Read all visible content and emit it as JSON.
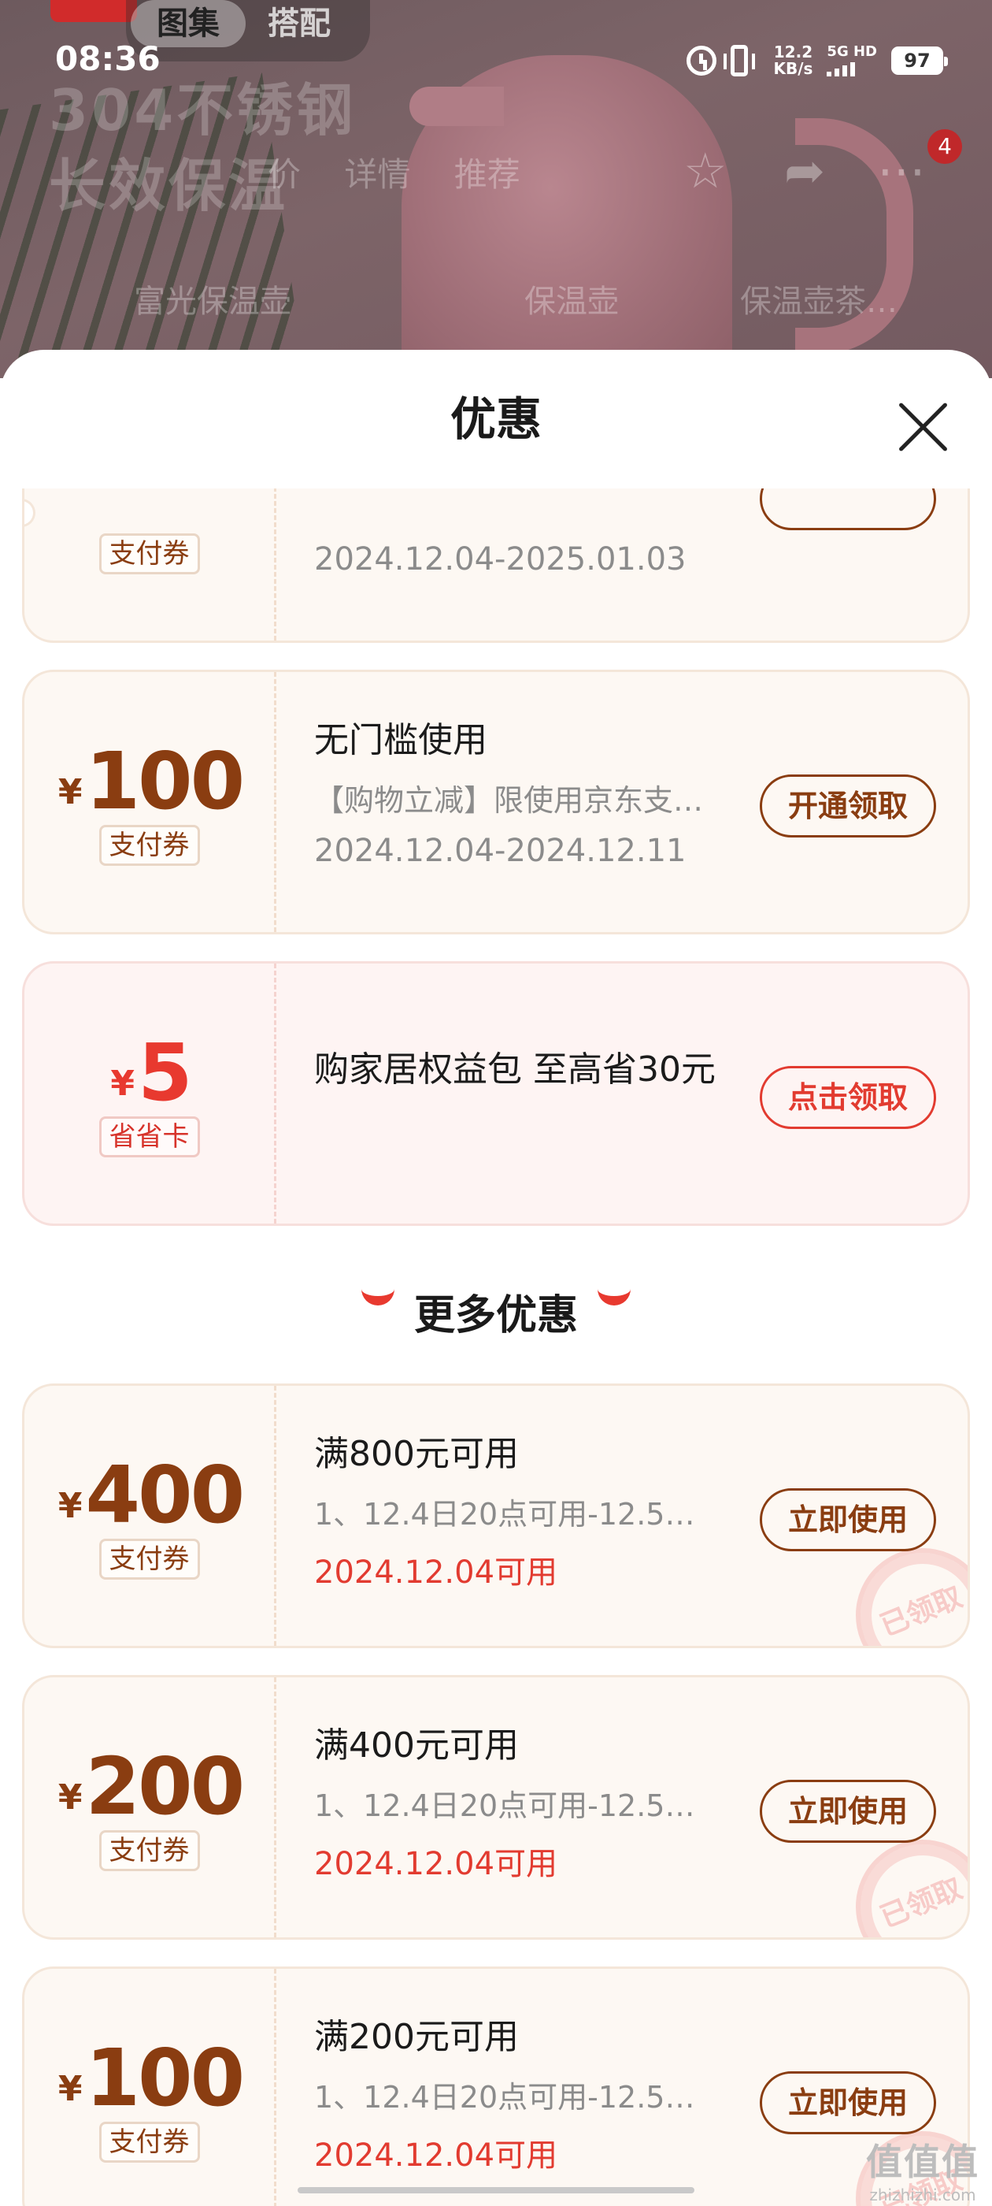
{
  "status_bar": {
    "time": "08:36",
    "net_speed_value": "12.2",
    "net_speed_unit": "KB/s",
    "network": "5G HD",
    "battery": "97"
  },
  "background_page": {
    "media_tabs": [
      "图集",
      "搭配"
    ],
    "headline_line1": "304不锈钢",
    "headline_line2": "长效保温",
    "nav_tabs": [
      "价",
      "详情",
      "推荐"
    ],
    "cart_badge": "4",
    "sub_tabs": [
      "富光保温壶",
      "保温壶",
      "保温壶茶…"
    ]
  },
  "sheet": {
    "title": "优惠",
    "more_section_title": "更多优惠"
  },
  "coupons": [
    {
      "amount": "",
      "tag": "支付券",
      "title": "",
      "desc": "",
      "date": "2024.12.04-2025.01.03",
      "button": ""
    },
    {
      "amount": "100",
      "tag": "支付券",
      "title": "无门槛使用",
      "desc": "【购物立减】限使用京东支付…",
      "date": "2024.12.04-2024.12.11",
      "button": "开通领取"
    },
    {
      "amount": "5",
      "tag": "省省卡",
      "title": "购家居权益包 至高省30元",
      "desc": "",
      "date": "",
      "button": "点击领取"
    }
  ],
  "more_coupons": [
    {
      "amount": "400",
      "tag": "支付券",
      "title": "满800元可用",
      "desc": "1、12.4日20点可用-12.5…",
      "date": "2024.12.04可用",
      "button": "立即使用",
      "stamp": "已领取"
    },
    {
      "amount": "200",
      "tag": "支付券",
      "title": "满400元可用",
      "desc": "1、12.4日20点可用-12.5…",
      "date": "2024.12.04可用",
      "button": "立即使用",
      "stamp": "已领取"
    },
    {
      "amount": "100",
      "tag": "支付券",
      "title": "满200元可用",
      "desc": "1、12.4日20点可用-12.5…",
      "date": "2024.12.04可用",
      "button": "立即使用",
      "stamp": "已领取"
    }
  ],
  "currency_symbol": "¥",
  "watermark": {
    "main": "值值值",
    "sub": "zhizhizhi.com"
  },
  "colors": {
    "accent_brown": "#8a3d11",
    "accent_red": "#e23b30",
    "card_bg": "#fdf8f3",
    "card_pink_bg": "#fef4f3"
  }
}
